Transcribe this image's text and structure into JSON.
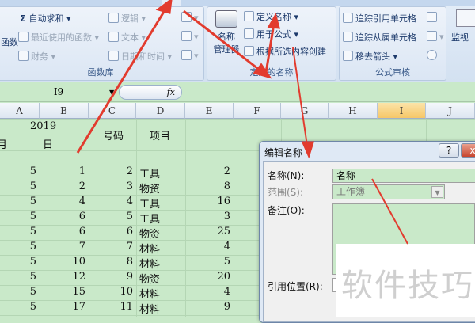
{
  "ribbon": {
    "group_function_library": {
      "label": "函数库",
      "partial_left": "函数",
      "autosum": "自动求和",
      "recent": "最近使用的函数",
      "financial": "财务",
      "logical": "逻辑",
      "text": "文本",
      "datetime": "日期和时间"
    },
    "group_defined_names": {
      "label": "定义的名称",
      "name_manager": [
        "名称",
        "管理器"
      ],
      "define_name": "定义名称",
      "use_in_formula": "用于公式",
      "create_from_selection": "根据所选内容创建"
    },
    "group_formula_auditing": {
      "label": "公式审核",
      "trace_precedents": "追踪引用单元格",
      "trace_dependents": "追踪从属单元格",
      "remove_arrows": "移去箭头"
    },
    "watch_window": "监视"
  },
  "formula_bar": {
    "name_box": "I9",
    "fx": "fx",
    "value": ""
  },
  "columns": [
    "A",
    "B",
    "C",
    "D",
    "E",
    "F",
    "G",
    "H",
    "I",
    "J"
  ],
  "selected_column": "I",
  "sheet": {
    "header": {
      "year": "2019",
      "month": "月",
      "day": "日",
      "number": "号码",
      "item": "项目"
    },
    "rows": [
      {
        "a": "5",
        "b": "1",
        "c": "2",
        "d": "工具",
        "e": "2"
      },
      {
        "a": "5",
        "b": "2",
        "c": "3",
        "d": "物资",
        "e": "8"
      },
      {
        "a": "5",
        "b": "4",
        "c": "4",
        "d": "工具",
        "e": "16"
      },
      {
        "a": "5",
        "b": "6",
        "c": "5",
        "d": "工具",
        "e": "3"
      },
      {
        "a": "5",
        "b": "6",
        "c": "6",
        "d": "物资",
        "e": "25"
      },
      {
        "a": "5",
        "b": "7",
        "c": "7",
        "d": "材料",
        "e": "4"
      },
      {
        "a": "5",
        "b": "10",
        "c": "8",
        "d": "材料",
        "e": "5"
      },
      {
        "a": "5",
        "b": "12",
        "c": "9",
        "d": "物资",
        "e": "20"
      },
      {
        "a": "5",
        "b": "15",
        "c": "10",
        "d": "材料",
        "e": "4"
      },
      {
        "a": "5",
        "b": "17",
        "c": "11",
        "d": "材料",
        "e": "9"
      }
    ]
  },
  "dialog": {
    "title": "编辑名称",
    "help": "?",
    "close": "x",
    "name_label": "名称(N):",
    "name_value": "名称",
    "scope_label": "范围(S):",
    "scope_value": "工作簿",
    "comment_label": "备注(O):",
    "comment_value": "",
    "refers_label": "引用位置(R):",
    "refers_value": "="
  },
  "watermark": "软件技巧",
  "colors": {
    "cell_bg": "#c9e9c9",
    "arrow": "#e23b2e",
    "selected_col": "#f6c768"
  }
}
